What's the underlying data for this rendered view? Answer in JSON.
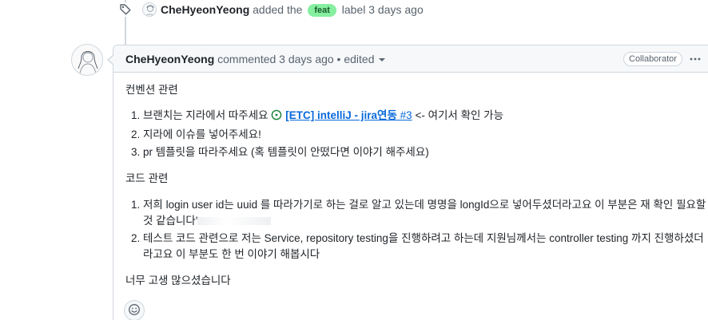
{
  "event": {
    "actor": "CheHyeonYeong",
    "action_prefix": "added the",
    "label": "feat",
    "action_suffix": "label 3 days ago"
  },
  "comment": {
    "author": "CheHyeonYeong",
    "meta": "commented 3 days ago • edited",
    "role_badge": "Collaborator",
    "section1_heading": "컨벤션 관련",
    "section1_items": [
      {
        "before": "브랜치는 지라에서 따주세요 ",
        "link_text": "[ETC] intelliJ - jira연동",
        "link_num": " #3",
        "after": " <- 여기서 확인 가능"
      },
      {
        "text": "지라에 이슈를 넣어주세요!"
      },
      {
        "text": "pr 템플릿을 따라주세요 (혹 템플릿이 안떴다면 이야기 해주세요)"
      }
    ],
    "section2_heading": "코드 관련",
    "section2_items": [
      {
        "text": "저희 login user id는 uuid 를 따라가기로 하는 걸로 알고 있는데 명명을 longId으로 넣어두셨더라고요 이 부분은 재 확인 필요할 것 같습니다'"
      },
      {
        "text": "테스트 코드 관련으로 저는 Service, repository testing을 진행하려고 하는데 지원님께서는 controller testing 까지 진행하셨더라고요 이 부분도 한 번 이야기 해봅시다"
      }
    ],
    "closing": "너무 고생 많으셨습니다"
  },
  "icons": {
    "tag": "tag-icon",
    "kebab": "kebab-horizontal-icon",
    "issue_open": "issue-opened-icon",
    "smiley": "smiley-icon",
    "edited_dropdown": "triangle-down-icon"
  },
  "colors": {
    "label_bg": "#86efa0",
    "link": "#0969da",
    "open_issue": "#1a7f37",
    "border": "#d0d7de",
    "header_bg": "#f6f8fa"
  }
}
